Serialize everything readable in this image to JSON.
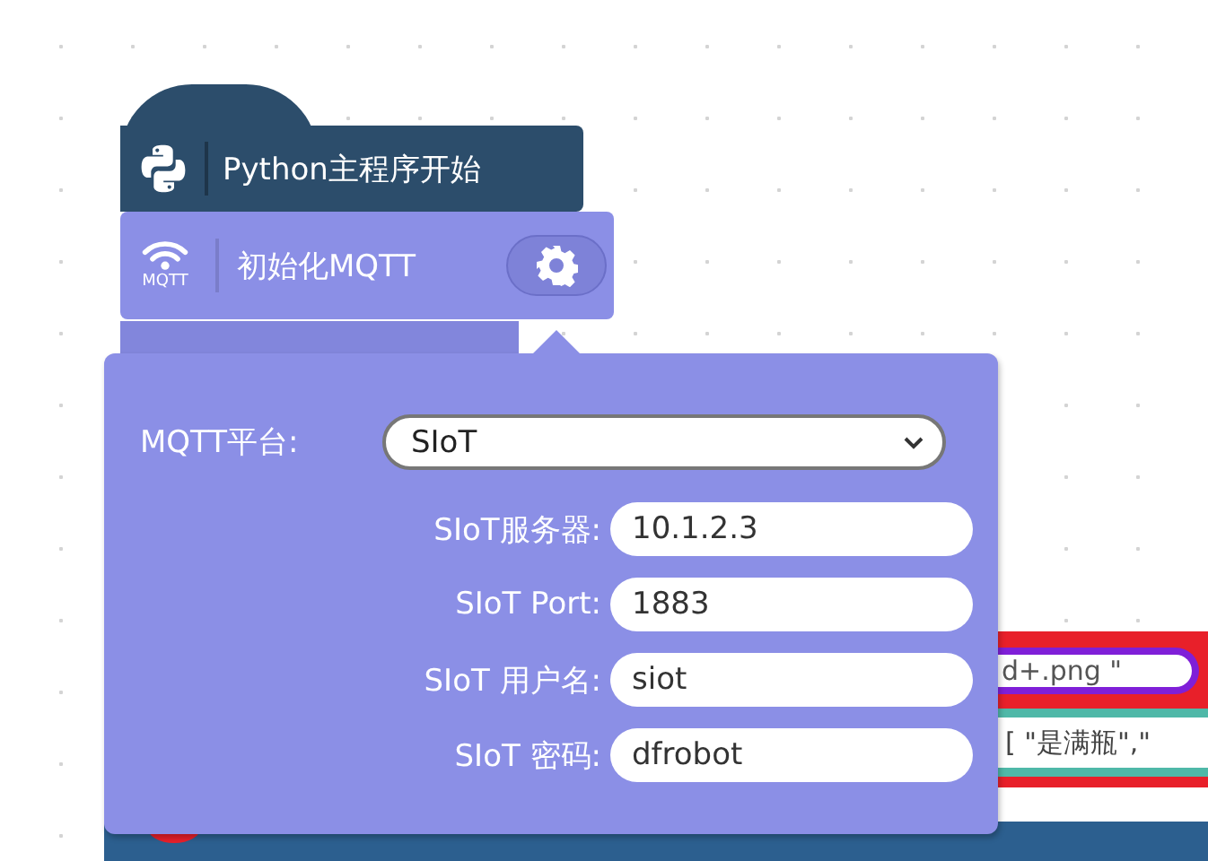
{
  "blocks": [
    {
      "kind": "hat",
      "label": "Python主程序开始"
    },
    {
      "kind": "mqtt",
      "label": "初始化MQTT",
      "icon_label": "MQTT"
    }
  ],
  "popup": {
    "platform": {
      "label": "MQTT平台:",
      "value": "SIoT"
    },
    "fields": [
      {
        "label": "SIoT服务器:",
        "value": "10.1.2.3"
      },
      {
        "label": "SIoT Port:",
        "value": "1883"
      },
      {
        "label": "SIoT 用户名:",
        "value": "siot"
      },
      {
        "label": "SIoT 密码:",
        "value": "dfrobot"
      }
    ]
  },
  "background_blocks": [
    {
      "kind": "string",
      "text": "d+.png \""
    },
    {
      "kind": "list",
      "text": "[ \"是满瓶\",\""
    }
  ]
}
